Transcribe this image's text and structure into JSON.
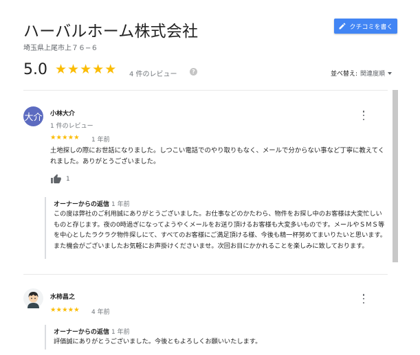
{
  "header": {
    "title": "ハーバルホーム株式会社",
    "address": "埼玉県上尾市上７６−６",
    "write_review_label": "クチコミを書く"
  },
  "summary": {
    "rating": "5.0",
    "stars": 5,
    "review_count": "4 件のレビュー",
    "sort_label": "並べ替え:",
    "sort_value": "関連度順",
    "star_color": "#fbbc04"
  },
  "reviews": [
    {
      "avatar_text": "大介",
      "avatar_color": "#5c6bc0",
      "name": "小林大介",
      "sub": "1 件のレビュー",
      "stars": 5,
      "time": "1 年前",
      "text": "土地探しの際にお世話になりました。しつこい電話でのやり取りもなく、メールで分からない事など丁寧に教えてくれました。ありがとうございました。",
      "likes": "1",
      "reply": {
        "who": "オーナーからの返信",
        "when": "1 年前",
        "text": "この度は弊社のご利用誠にありがとうございました。お仕事などのかたわら、物件をお探し中のお客様は大変忙しいものと存じます。夜の0時過ぎになってようやくメールをお送り頂けるお客様も大変多いものです。メールやＳＭＳ等を中心としたラクラク物件探しにて、すべてのお客様にご満足頂ける様、今後も精一杯努めてまいりたいと思います。また機会がございましたお気軽にお声掛けくださいませ。次回お目にかかれることを楽しみに致しております。"
      }
    },
    {
      "avatar_icon": "person-avatar-icon",
      "name": "水柿昌之",
      "stars": 5,
      "time": "4 年前",
      "reply": {
        "who": "オーナーからの返信",
        "when": "1 年前",
        "text": "評価誠にありがとうございました。今後ともよろしくお願いいたします。"
      }
    }
  ]
}
